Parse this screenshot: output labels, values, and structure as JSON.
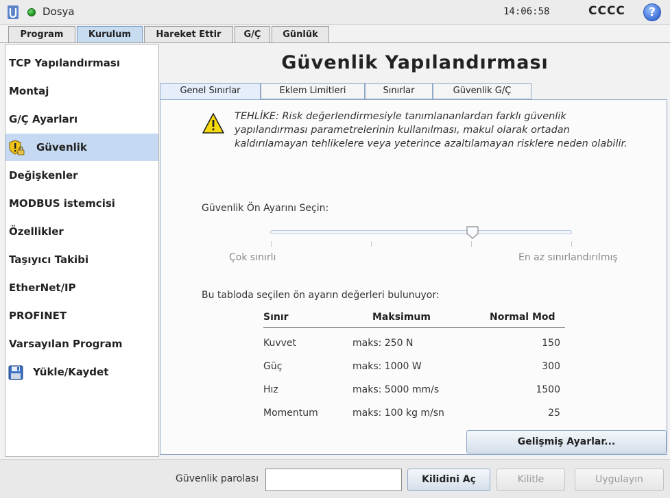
{
  "topbar": {
    "file_label": "Dosya",
    "clock": "14:06:58",
    "robot_name": "CCCC",
    "help_glyph": "?"
  },
  "main_tabs": [
    "Program",
    "Kurulum",
    "Hareket Ettir",
    "G/Ç",
    "Günlük"
  ],
  "active_main_tab": "Kurulum",
  "sidebar": {
    "items": [
      {
        "label": "TCP Yapılandırması"
      },
      {
        "label": "Montaj"
      },
      {
        "label": "G/Ç Ayarları"
      },
      {
        "label": "Güvenlik",
        "icon": "safety-shield-lock-icon",
        "active": true
      },
      {
        "label": "Değişkenler"
      },
      {
        "label": "MODBUS istemcisi"
      },
      {
        "label": "Özellikler"
      },
      {
        "label": "Taşıyıcı Takibi"
      },
      {
        "label": "EtherNet/IP"
      },
      {
        "label": "PROFINET"
      },
      {
        "label": "Varsayılan Program"
      },
      {
        "label": "Yükle/Kaydet",
        "icon": "floppy-disk-icon"
      }
    ]
  },
  "page": {
    "title": "Güvenlik Yapılandırması",
    "sub_tabs": [
      "Genel Sınırlar",
      "Eklem Limitleri",
      "Sınırlar",
      "Güvenlik G/Ç"
    ],
    "active_sub_tab": "Genel Sınırlar",
    "warning": "TEHLİKE: Risk değerlendirmesiyle tanımlananlardan farklı güvenlik yapılandırması parametrelerinin kullanılması, makul olarak ortadan kaldırılamayan tehlikelere veya yeterince azaltılamayan risklere neden olabilir.",
    "preset_label": "Güvenlik Ön Ayarını Seçin:",
    "slider": {
      "left_label": "Çok sınırlı",
      "right_label": "En az sınırlandırılmış",
      "value_fraction": 0.67
    },
    "table_description": "Bu tabloda seçilen ön ayarın değerleri bulunuyor:",
    "table": {
      "headers": [
        "Sınır",
        "Maksimum",
        "Normal Mod"
      ],
      "rows": [
        [
          "Kuvvet",
          "maks: 250 N",
          "150"
        ],
        [
          "Güç",
          "maks: 1000 W",
          "300"
        ],
        [
          "Hız",
          "maks: 5000 mm/s",
          "1500"
        ],
        [
          "Momentum",
          "maks: 100 kg m/sn",
          "25"
        ]
      ]
    },
    "advanced_button": "Gelişmiş Ayarlar..."
  },
  "bottom": {
    "password_label": "Güvenlik parolası",
    "password_value": "",
    "unlock_button": "Kilidini Aç",
    "lock_button": "Kilitle",
    "apply_button": "Uygulayın"
  },
  "colors": {
    "accent_tab": "#c7dbf1",
    "sidebar_active": "#c5daf2",
    "status_ok": "#1d8a1d",
    "help": "#3d6fd6"
  }
}
